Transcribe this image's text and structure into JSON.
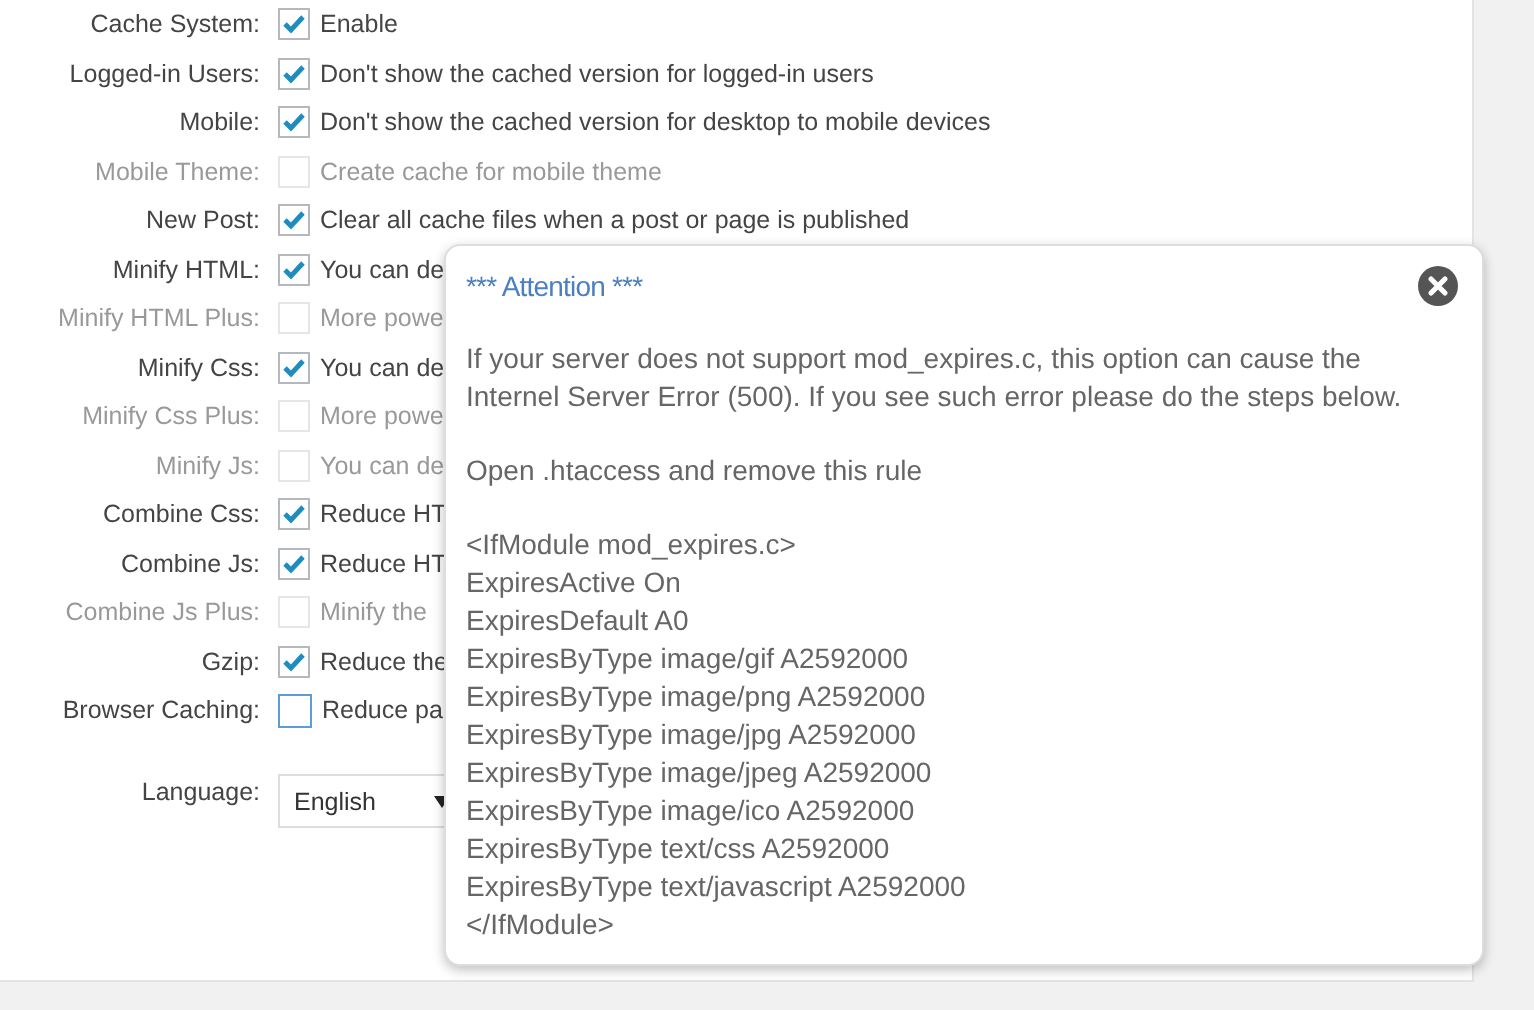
{
  "settings": [
    {
      "label": "Cache System:",
      "text": "Enable",
      "checked": true,
      "disabled": false
    },
    {
      "label": "Logged-in Users:",
      "text": "Don't show the cached version for logged-in users",
      "checked": true,
      "disabled": false
    },
    {
      "label": "Mobile:",
      "text": "Don't show the cached version for desktop to mobile devices",
      "checked": true,
      "disabled": false
    },
    {
      "label": "Mobile Theme:",
      "text": "Create cache for mobile theme",
      "checked": false,
      "disabled": true
    },
    {
      "label": "New Post:",
      "text": "Clear all cache files when a post or page is published",
      "checked": true,
      "disabled": false
    },
    {
      "label": "Minify HTML:",
      "text": "You can de",
      "checked": true,
      "disabled": false
    },
    {
      "label": "Minify HTML Plus:",
      "text": "More powe",
      "checked": false,
      "disabled": true
    },
    {
      "label": "Minify Css:",
      "text": "You can de",
      "checked": true,
      "disabled": false
    },
    {
      "label": "Minify Css Plus:",
      "text": "More powe",
      "checked": false,
      "disabled": true
    },
    {
      "label": "Minify Js:",
      "text": "You can de",
      "checked": false,
      "disabled": true
    },
    {
      "label": "Combine Css:",
      "text": "Reduce HT",
      "checked": true,
      "disabled": false
    },
    {
      "label": "Combine Js:",
      "text": "Reduce HT",
      "checked": true,
      "disabled": false
    },
    {
      "label": "Combine Js Plus:",
      "text": "Minify the",
      "checked": false,
      "disabled": true
    },
    {
      "label": "Gzip:",
      "text": "Reduce the",
      "checked": true,
      "disabled": false
    },
    {
      "label": "Browser Caching:",
      "text": "Reduce pa",
      "checked": false,
      "disabled": false
    }
  ],
  "language": {
    "label": "Language:",
    "value": "English"
  },
  "popup": {
    "title": "*** Attention ***",
    "paragraphs": [
      "If your server does not support mod_expires.c, this option can cause the Internel Server Error (500). If you see such error please do the steps below.",
      "Open .htaccess and remove this rule"
    ],
    "code_lines": [
      "<IfModule mod_expires.c>",
      "ExpiresActive On",
      "ExpiresDefault A0",
      "ExpiresByType image/gif A2592000",
      "ExpiresByType image/png A2592000",
      "ExpiresByType image/jpg A2592000",
      "ExpiresByType image/jpeg A2592000",
      "ExpiresByType image/ico A2592000",
      "ExpiresByType text/css A2592000",
      "ExpiresByType text/javascript A2592000",
      "</IfModule>"
    ]
  }
}
